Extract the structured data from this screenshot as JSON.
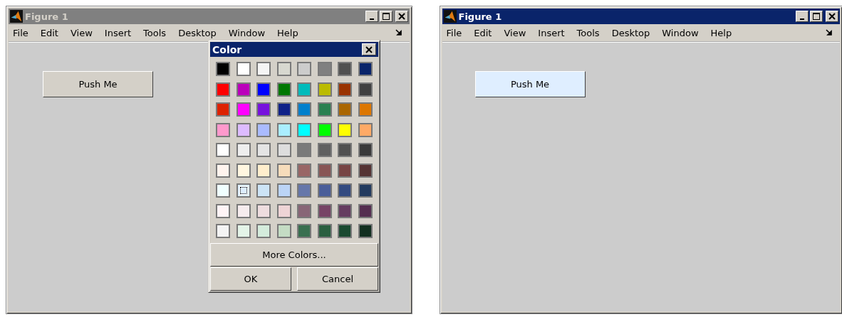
{
  "windows": [
    {
      "title": "Figure 1",
      "active": false,
      "menu": [
        "File",
        "Edit",
        "View",
        "Insert",
        "Tools",
        "Desktop",
        "Window",
        "Help"
      ],
      "button": {
        "label": "Push Me",
        "color": "#d4d0c8"
      },
      "dialog": {
        "title": "Color",
        "swatches": [
          [
            {
              "color": "#000000",
              "selected": false
            },
            {
              "color": "#ffffff",
              "selected": false
            },
            {
              "color": "#f5f5f5",
              "selected": false
            },
            {
              "color": "#d8d8d0",
              "selected": false
            },
            {
              "color": "#cccccc",
              "selected": false
            },
            {
              "color": "#808080",
              "selected": false
            },
            {
              "color": "#505050",
              "selected": false
            },
            {
              "color": "#0a246a",
              "selected": false
            }
          ],
          [
            {
              "color": "#ff0000",
              "selected": false
            },
            {
              "color": "#bb00bb",
              "selected": false
            },
            {
              "color": "#0000ff",
              "selected": false
            },
            {
              "color": "#007700",
              "selected": false
            },
            {
              "color": "#00bbbb",
              "selected": false
            },
            {
              "color": "#bbbb00",
              "selected": false
            },
            {
              "color": "#993300",
              "selected": false
            },
            {
              "color": "#404040",
              "selected": false
            }
          ],
          [
            {
              "color": "#dd2200",
              "selected": false
            },
            {
              "color": "#ff00ff",
              "selected": false
            },
            {
              "color": "#7711dd",
              "selected": false
            },
            {
              "color": "#112288",
              "selected": false
            },
            {
              "color": "#0080cc",
              "selected": false
            },
            {
              "color": "#2a8050",
              "selected": false
            },
            {
              "color": "#aa6600",
              "selected": false
            },
            {
              "color": "#dd7700",
              "selected": false
            }
          ],
          [
            {
              "color": "#ff99cc",
              "selected": false
            },
            {
              "color": "#ddbbff",
              "selected": false
            },
            {
              "color": "#aabbff",
              "selected": false
            },
            {
              "color": "#aaeeff",
              "selected": false
            },
            {
              "color": "#00ffff",
              "selected": false
            },
            {
              "color": "#00ff00",
              "selected": false
            },
            {
              "color": "#ffff00",
              "selected": false
            },
            {
              "color": "#ffaa66",
              "selected": false
            }
          ],
          [
            {
              "color": "#ffffff",
              "selected": false
            },
            {
              "color": "#eeeeee",
              "selected": false
            },
            {
              "color": "#e4e4e4",
              "selected": false
            },
            {
              "color": "#dddddd",
              "selected": false
            },
            {
              "color": "#7a7a7a",
              "selected": false
            },
            {
              "color": "#606060",
              "selected": false
            },
            {
              "color": "#505050",
              "selected": false
            },
            {
              "color": "#3a3a3a",
              "selected": false
            }
          ],
          [
            {
              "color": "#fff4ee",
              "selected": false
            },
            {
              "color": "#fff6e0",
              "selected": false
            },
            {
              "color": "#ffeecc",
              "selected": false
            },
            {
              "color": "#f6dcbb",
              "selected": false
            },
            {
              "color": "#996666",
              "selected": false
            },
            {
              "color": "#885555",
              "selected": false
            },
            {
              "color": "#774444",
              "selected": false
            },
            {
              "color": "#553333",
              "selected": false
            }
          ],
          [
            {
              "color": "#f0ffff",
              "selected": false
            },
            {
              "color": "#ddeeff",
              "selected": true
            },
            {
              "color": "#cce4f6",
              "selected": false
            },
            {
              "color": "#bbd4f6",
              "selected": false
            },
            {
              "color": "#6677aa",
              "selected": false
            },
            {
              "color": "#4a5e99",
              "selected": false
            },
            {
              "color": "#334a80",
              "selected": false
            },
            {
              "color": "#223a5e",
              "selected": false
            }
          ],
          [
            {
              "color": "#fff4f6",
              "selected": false
            },
            {
              "color": "#f6ecee",
              "selected": false
            },
            {
              "color": "#eedddf",
              "selected": false
            },
            {
              "color": "#eed4d6",
              "selected": false
            },
            {
              "color": "#886677",
              "selected": false
            },
            {
              "color": "#774466",
              "selected": false
            },
            {
              "color": "#663c60",
              "selected": false
            },
            {
              "color": "#552e50",
              "selected": false
            }
          ],
          [
            {
              "color": "#f4f4f4",
              "selected": false
            },
            {
              "color": "#e4f4e8",
              "selected": false
            },
            {
              "color": "#d4ecdc",
              "selected": false
            },
            {
              "color": "#c4dcc4",
              "selected": false
            },
            {
              "color": "#3a7050",
              "selected": false
            },
            {
              "color": "#2a6040",
              "selected": false
            },
            {
              "color": "#1a4a30",
              "selected": false
            },
            {
              "color": "#123020",
              "selected": false
            }
          ]
        ],
        "more_button": "More Colors...",
        "ok_button": "OK",
        "cancel_button": "Cancel"
      }
    },
    {
      "title": "Figure 1",
      "active": true,
      "menu": [
        "File",
        "Edit",
        "View",
        "Insert",
        "Tools",
        "Desktop",
        "Window",
        "Help"
      ],
      "button": {
        "label": "Push Me",
        "color": "#dfeeff"
      }
    }
  ]
}
